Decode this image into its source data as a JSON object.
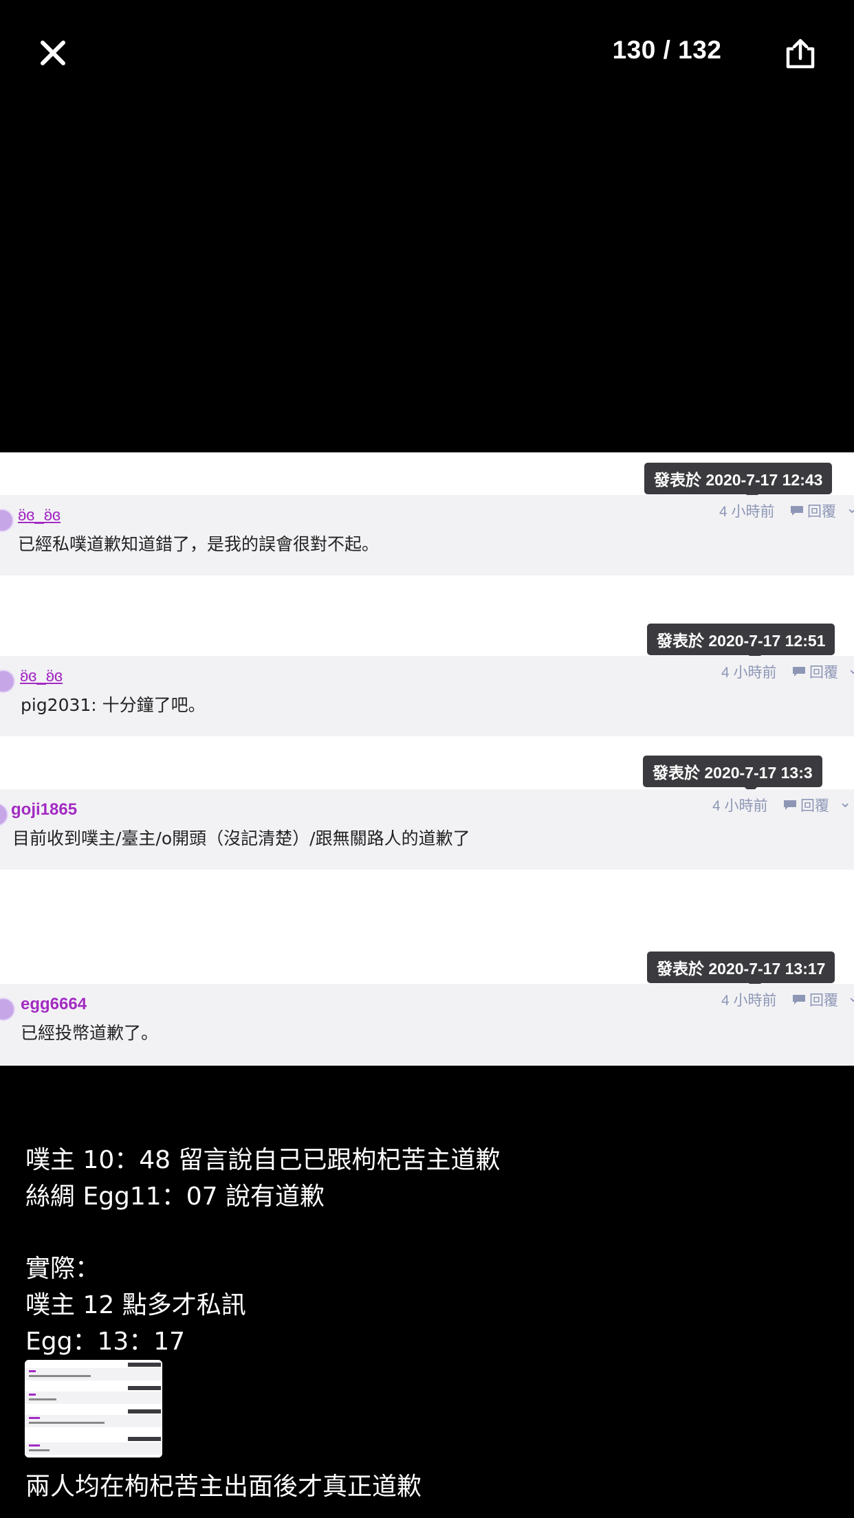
{
  "viewer": {
    "counter": "130 / 132",
    "close_icon": "close-icon",
    "share_icon": "share-icon"
  },
  "posts": [
    {
      "timestamp": "發表於 2020-7-17 12:43",
      "username": "ʚ̈ɞ_ʚ̈ɞ",
      "time_ago": "4 小時前",
      "reply_label": "回覆",
      "message": "已經私噗道歉知道錯了，是我的誤會很對不起。"
    },
    {
      "timestamp": "發表於 2020-7-17 12:51",
      "username": "ʚ̈ɞ_ʚ̈ɞ",
      "time_ago": "4 小時前",
      "reply_label": "回覆",
      "message": "pig2031: 十分鐘了吧。"
    },
    {
      "timestamp": "發表於 2020-7-17 13:3",
      "username": "goji1865",
      "time_ago": "4 小時前",
      "reply_label": "回覆",
      "message": "目前收到噗主/臺主/o開頭（沒記清楚）/跟無關路人的道歉了"
    },
    {
      "timestamp": "發表於 2020-7-17 13:17",
      "username": "egg6664",
      "time_ago": "4 小時前",
      "reply_label": "回覆",
      "message": "已經投幣道歉了。"
    }
  ],
  "caption": {
    "line1": "噗主 10：48 留言說自己已跟枸杞苦主道歉",
    "line2": "絲綢 Egg11：07 說有道歉",
    "line3": "實際：",
    "line4": "噗主 12 點多才私訊",
    "line5": "Egg：13：17",
    "line6": "兩人均在枸杞苦主出面後才真正道歉"
  },
  "colors": {
    "background": "#000000",
    "tooltip": "#3b3b3f",
    "username": "#a32bc2",
    "meta": "#8d97b5",
    "post_bg": "#f2f2f5"
  }
}
